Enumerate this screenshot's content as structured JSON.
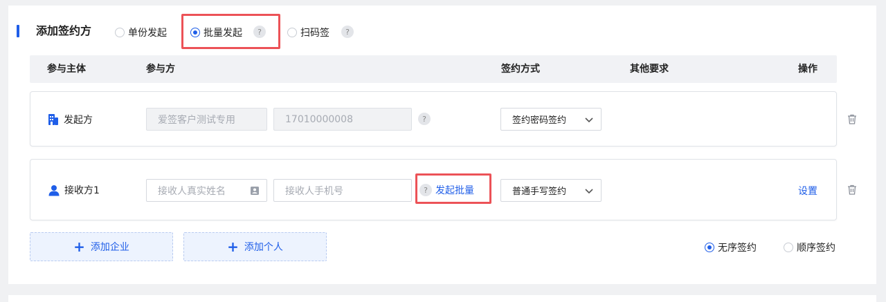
{
  "section": {
    "title": "添加签约方",
    "modes": [
      {
        "label": "单份发起",
        "selected": false
      },
      {
        "label": "批量发起",
        "selected": true
      },
      {
        "label": "扫码签",
        "selected": false
      }
    ],
    "help_glyph": "?"
  },
  "table": {
    "headers": [
      "参与主体",
      "参与方",
      "签约方式",
      "其他要求",
      "操作"
    ]
  },
  "rows": [
    {
      "party_type": "发起方",
      "icon": "building-icon",
      "field1": "爱签客户测试专用",
      "field2": "17010000008",
      "sign_method": "签约密码签约"
    },
    {
      "party_type": "接收方1",
      "icon": "user-icon",
      "field1_placeholder": "接收人真实姓名",
      "field2_placeholder": "接收人手机号",
      "batch_link": "发起批量",
      "sign_method": "普通手写签约",
      "action": "设置"
    }
  ],
  "buttons": {
    "add_company": "添加企业",
    "add_person": "添加个人"
  },
  "order": [
    {
      "label": "无序签约",
      "selected": true
    },
    {
      "label": "顺序签约",
      "selected": false
    }
  ],
  "colors": {
    "accent": "#1f5ee8",
    "highlight": "#ec5257"
  }
}
